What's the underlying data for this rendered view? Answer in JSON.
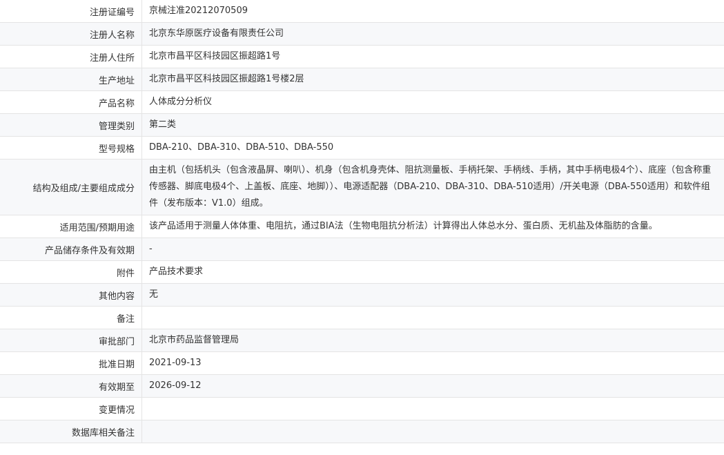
{
  "rows": [
    {
      "label": "注册证编号",
      "value": "京械注准20212070509"
    },
    {
      "label": "注册人名称",
      "value": "北京东华原医疗设备有限责任公司"
    },
    {
      "label": "注册人住所",
      "value": "北京市昌平区科技园区振超路1号"
    },
    {
      "label": "生产地址",
      "value": "北京市昌平区科技园区振超路1号楼2层"
    },
    {
      "label": "产品名称",
      "value": "人体成分分析仪"
    },
    {
      "label": "管理类别",
      "value": "第二类"
    },
    {
      "label": "型号规格",
      "value": "DBA-210、DBA-310、DBA-510、DBA-550"
    },
    {
      "label": "结构及组成/主要组成成分",
      "value": "由主机（包括机头（包含液晶屏、喇叭）、机身（包含机身壳体、阻抗测量板、手柄托架、手柄线、手柄，其中手柄电极4个）、底座（包含称重传感器、脚底电极4个、上盖板、底座、地脚））、电源适配器（DBA-210、DBA-310、DBA-510适用）/开关电源（DBA-550适用）和软件组件（发布版本：V1.0）组成。"
    },
    {
      "label": "适用范围/预期用途",
      "value": "该产品适用于测量人体体重、电阻抗，通过BIA法（生物电阻抗分析法）计算得出人体总水分、蛋白质、无机盐及体脂肪的含量。"
    },
    {
      "label": "产品储存条件及有效期",
      "value": "-"
    },
    {
      "label": "附件",
      "value": "产品技术要求"
    },
    {
      "label": "其他内容",
      "value": "无"
    },
    {
      "label": "备注",
      "value": ""
    },
    {
      "label": "审批部门",
      "value": "北京市药品监督管理局"
    },
    {
      "label": "批准日期",
      "value": "2021-09-13"
    },
    {
      "label": "有效期至",
      "value": "2026-09-12"
    },
    {
      "label": "变更情况",
      "value": ""
    },
    {
      "label": "数据库相关备注",
      "value": ""
    }
  ]
}
